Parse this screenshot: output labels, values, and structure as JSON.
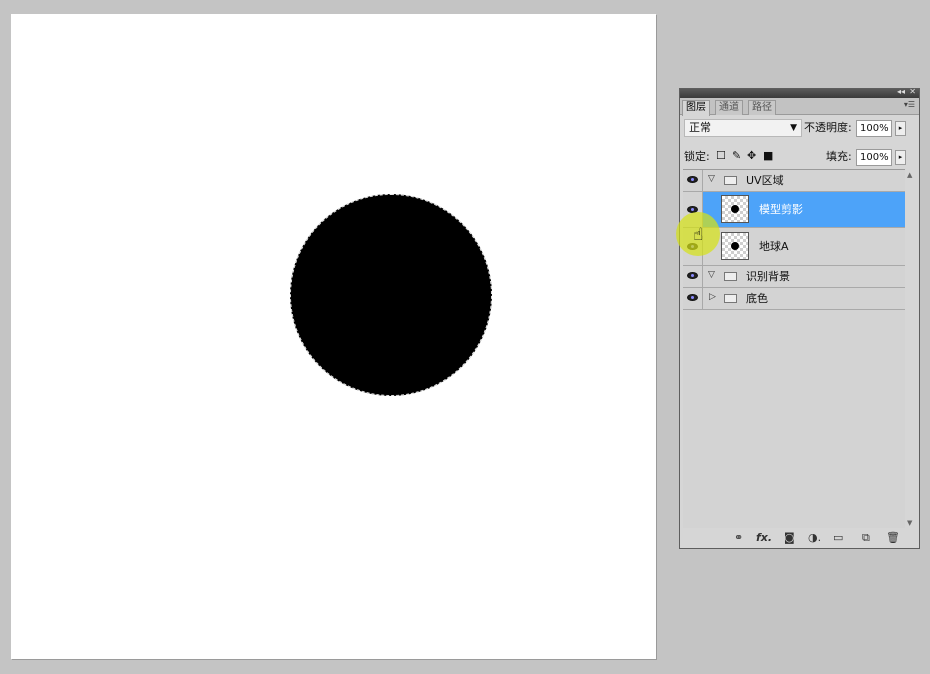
{
  "panel": {
    "tabs": [
      {
        "label": "图层",
        "active": true
      },
      {
        "label": "通道",
        "active": false
      },
      {
        "label": "路径",
        "active": false
      }
    ],
    "blend_mode": "正常",
    "opacity_label": "不透明度:",
    "opacity_value": "100%",
    "lock_label": "锁定:",
    "fill_label": "填充:",
    "fill_value": "100%",
    "layers": [
      {
        "name": "UV区域",
        "type": "group",
        "expanded": true,
        "visible": true,
        "selected": false
      },
      {
        "name": "模型剪影",
        "type": "layer",
        "visible": true,
        "selected": true
      },
      {
        "name": "地球A",
        "type": "layer",
        "visible": true,
        "selected": false
      },
      {
        "name": "识别背景",
        "type": "group",
        "expanded": true,
        "visible": true,
        "selected": false
      },
      {
        "name": "底色",
        "type": "group",
        "expanded": false,
        "visible": true,
        "selected": false
      }
    ],
    "bottom_icons": [
      "link-icon",
      "fx-icon",
      "mask-icon",
      "adjustment-icon",
      "group-icon",
      "new-layer-icon",
      "trash-icon"
    ]
  },
  "colors": {
    "selected_row": "#4da3f9",
    "canvas": "#ffffff",
    "workspace": "#c4c4c4"
  }
}
